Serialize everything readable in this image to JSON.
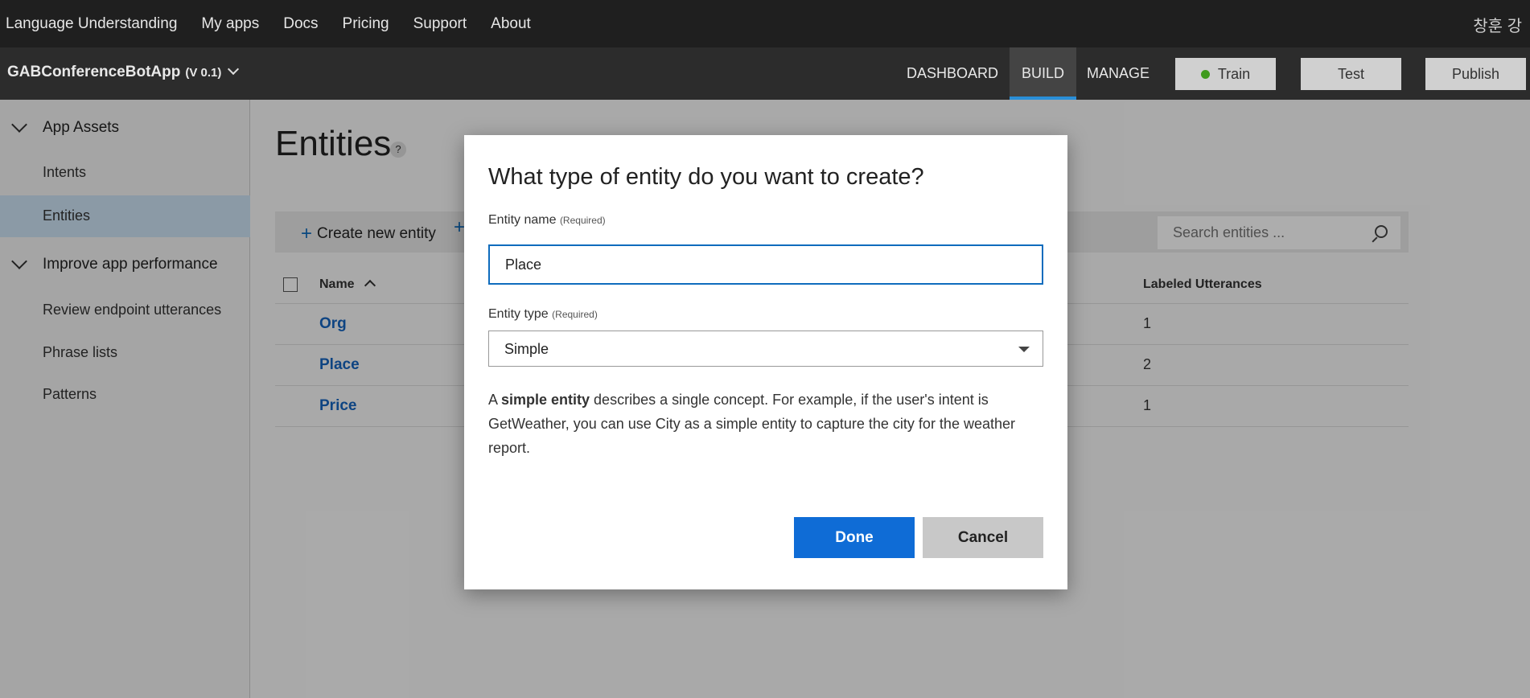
{
  "topnav": {
    "items": [
      "Language Understanding",
      "My apps",
      "Docs",
      "Pricing",
      "Support",
      "About"
    ],
    "user": "창훈 강"
  },
  "appbar": {
    "app_name": "GABConferenceBotApp",
    "version": "(V 0.1)",
    "tabs": [
      "DASHBOARD",
      "BUILD",
      "MANAGE"
    ],
    "active_tab": "BUILD",
    "train_label": "Train",
    "test_label": "Test",
    "publish_label": "Publish",
    "train_status_color": "#3f9a1d"
  },
  "sidebar": {
    "group1": "App Assets",
    "items1": [
      "Intents",
      "Entities"
    ],
    "active_item": "Entities",
    "group2": "Improve app performance",
    "items2": [
      "Review endpoint utterances",
      "Phrase lists",
      "Patterns"
    ]
  },
  "main": {
    "title": "Entities",
    "help": "?",
    "create_label": "Create new entity",
    "search_placeholder": "Search entities ...",
    "columns": {
      "name": "Name",
      "labeled": "Labeled Utterances"
    },
    "rows": [
      {
        "name": "Org",
        "count": "1"
      },
      {
        "name": "Place",
        "count": "2"
      },
      {
        "name": "Price",
        "count": "1"
      }
    ]
  },
  "dialog": {
    "title": "What type of entity do you want to create?",
    "name_label": "Entity name",
    "name_required": "(Required)",
    "name_value": "Place",
    "type_label": "Entity type",
    "type_required": "(Required)",
    "type_value": "Simple",
    "desc_prefix": "A ",
    "desc_bold": "simple entity",
    "desc_rest": " describes a single concept. For example, if the user's intent is GetWeather, you can use City as a simple entity to capture the city for the weather report.",
    "done_label": "Done",
    "cancel_label": "Cancel"
  }
}
